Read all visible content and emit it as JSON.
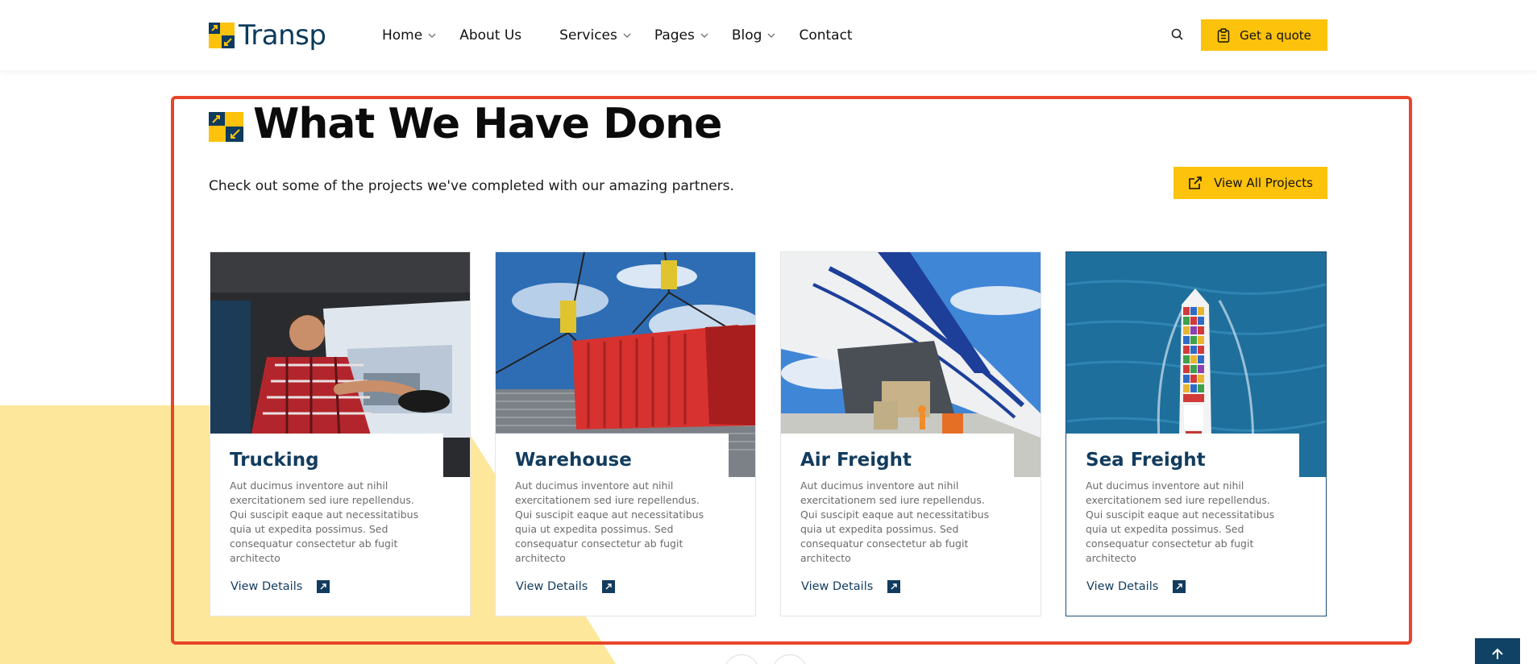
{
  "brand": {
    "name": "Transp"
  },
  "nav": {
    "items": [
      {
        "label": "Home",
        "dropdown": true
      },
      {
        "label": "About Us",
        "dropdown": false
      },
      {
        "label": "Services",
        "dropdown": true
      },
      {
        "label": "Pages",
        "dropdown": true
      },
      {
        "label": "Blog",
        "dropdown": true
      },
      {
        "label": "Contact",
        "dropdown": false
      }
    ],
    "quote_label": "Get a quote"
  },
  "section": {
    "title": "What We Have Done",
    "subtitle": "Check out some of the projects we've completed with our amazing partners.",
    "view_all_label": "View All Projects"
  },
  "cards": [
    {
      "title": "Trucking",
      "text": "Aut ducimus inventore aut nihil exercitationem sed iure repellendus. Qui suscipit eaque aut necessitatibus quia ut expedita possimus. Sed consequatur consectetur ab fugit architecto",
      "link": "View Details"
    },
    {
      "title": "Warehouse",
      "text": "Aut ducimus inventore aut nihil exercitationem sed iure repellendus. Qui suscipit eaque aut necessitatibus quia ut expedita possimus. Sed consequatur consectetur ab fugit architecto",
      "link": "View Details"
    },
    {
      "title": "Air Freight",
      "text": "Aut ducimus inventore aut nihil exercitationem sed iure repellendus. Qui suscipit eaque aut necessitatibus quia ut expedita possimus. Sed consequatur consectetur ab fugit architecto",
      "link": "View Details"
    },
    {
      "title": "Sea Freight",
      "text": "Aut ducimus inventore aut nihil exercitationem sed iure repellendus. Qui suscipit eaque aut necessitatibus quia ut expedita possimus. Sed consequatur consectetur ab fugit architecto",
      "link": "View Details"
    }
  ],
  "colors": {
    "accent": "#fcc20c",
    "navy": "#123c5e",
    "highlight": "#e8452a",
    "pale_yellow": "#fde79a"
  },
  "icons": [
    "logo-mark-icon",
    "chevron-down-icon",
    "search-icon",
    "clipboard-icon",
    "external-link-icon",
    "arrow-up-right-icon",
    "arrow-up-icon"
  ]
}
